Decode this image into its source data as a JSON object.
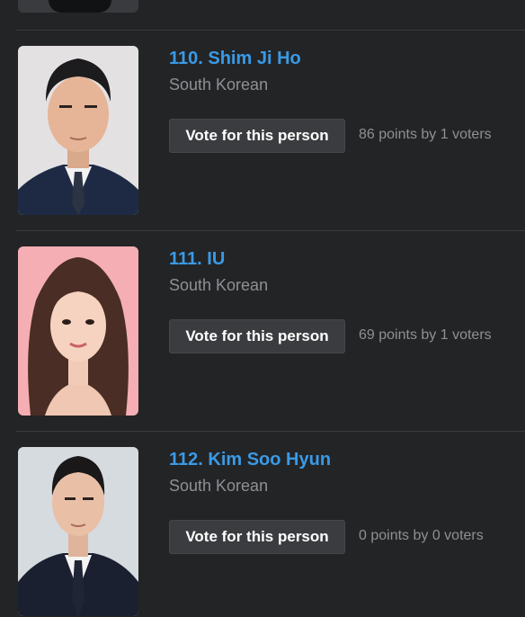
{
  "people": [
    {
      "name": "110. Shim Ji Ho",
      "nationality": "South Korean",
      "vote_label": "Vote for this person",
      "points_text": "86 points by 1 voters"
    },
    {
      "name": "111. IU",
      "nationality": "South Korean",
      "vote_label": "Vote for this person",
      "points_text": "69 points by 1 voters"
    },
    {
      "name": "112. Kim Soo Hyun",
      "nationality": "South Korean",
      "vote_label": "Vote for this person",
      "points_text": "0 points by 0 voters"
    }
  ],
  "colors": {
    "background": "#232426",
    "link": "#3a9ae6",
    "muted_text": "#8e9094",
    "button_bg": "#3b3c3f"
  }
}
